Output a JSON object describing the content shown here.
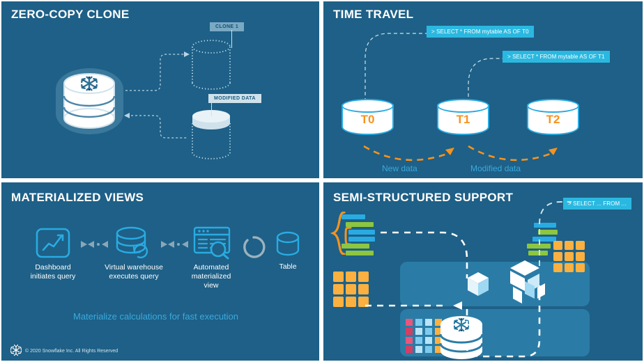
{
  "slide": {
    "background_color": "#ffffff",
    "panel_color": "#1e6087",
    "accent_cyan": "#29abe2",
    "accent_orange": "#f7931e",
    "accent_green": "#8dc63f"
  },
  "panels": {
    "zero_copy_clone": {
      "title": "ZERO-COPY CLONE",
      "source_label": "snowflake-database",
      "tags": [
        {
          "text": "CLONE 1"
        },
        {
          "text": "MODIFIED DATA"
        }
      ]
    },
    "time_travel": {
      "title": "TIME TRAVEL",
      "queries": [
        {
          "text": "> SELECT * FROM mytable AS OF T0"
        },
        {
          "text": "> SELECT * FROM mytable AS OF T1"
        }
      ],
      "cylinders": [
        {
          "label": "T0"
        },
        {
          "label": "T1"
        },
        {
          "label": "T2"
        }
      ],
      "transitions": [
        {
          "text": "New data"
        },
        {
          "text": "Modified data"
        }
      ]
    },
    "materialized_views": {
      "title": "MATERIALIZED VIEWS",
      "steps": [
        {
          "icon": "dashboard-chart-icon",
          "caption": "Dashboard\ninitiates query"
        },
        {
          "icon": "virtual-warehouse-icon",
          "caption": "Virtual warehouse\nexecutes query"
        },
        {
          "icon": "materialized-view-icon",
          "caption": "Automated\nmaterialized\nview"
        },
        {
          "icon": "table-cylinder-icon",
          "caption": "Table"
        }
      ],
      "tagline": "Materialize calculations for fast execution"
    },
    "semi_structured": {
      "title": "SEMI-STRUCTURED SUPPORT",
      "query": {
        "text": "> SELECT ... FROM ..."
      }
    }
  },
  "footer": {
    "logo": "snowflake-logo",
    "copyright": "© 2020 Snowflake Inc. All Rights Reserved"
  }
}
